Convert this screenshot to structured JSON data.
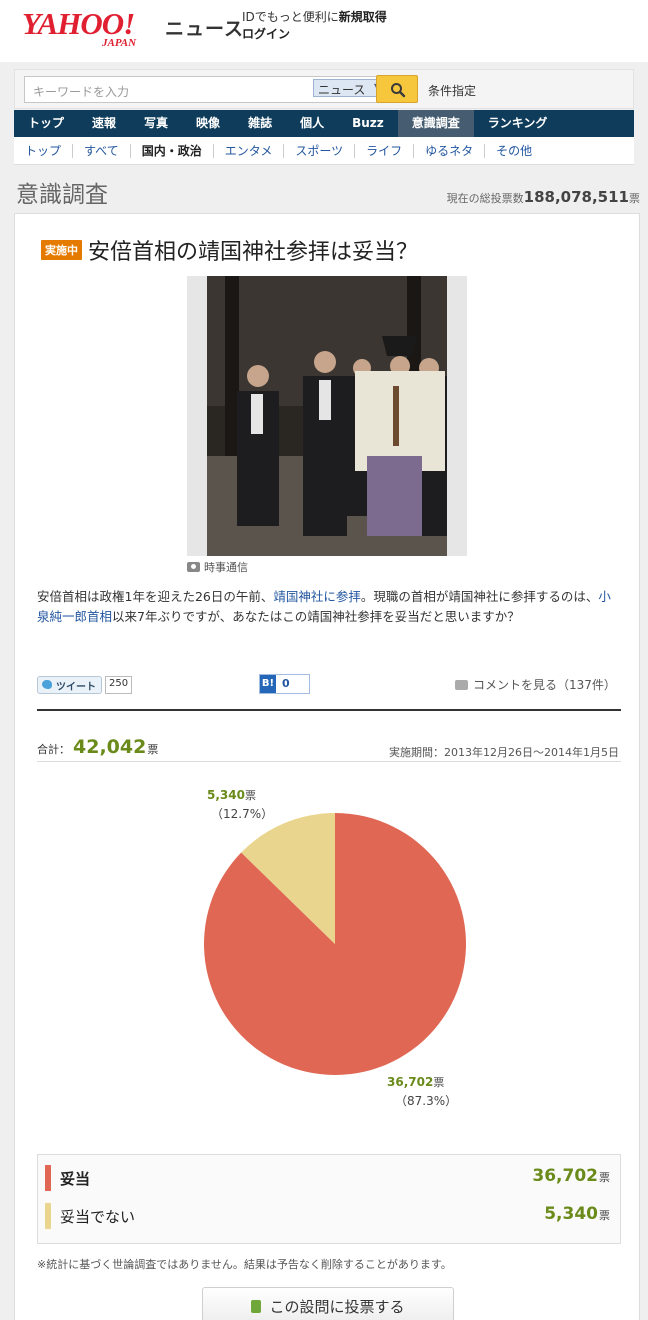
{
  "header": {
    "logo_main": "YAHOO!",
    "logo_sub": "JAPAN",
    "section": "ニュース",
    "id_text": "IDでもっと便利に",
    "register": "新規取得",
    "login": "ログイン"
  },
  "search": {
    "placeholder": "キーワードを入力",
    "scope": "ニュース",
    "advanced": "条件指定"
  },
  "main_nav": [
    "トップ",
    "速報",
    "写真",
    "映像",
    "雑誌",
    "個人",
    "Buzz",
    "意識調査",
    "ランキング"
  ],
  "main_nav_active": "意識調査",
  "sub_nav": [
    "トップ",
    "すべて",
    "国内・政治",
    "エンタメ",
    "スポーツ",
    "ライフ",
    "ゆるネタ",
    "その他"
  ],
  "sub_nav_current": "国内・政治",
  "page": {
    "title": "意識調査",
    "total_label": "現在の総投票数",
    "total_value": "188,078,511",
    "total_unit": "票"
  },
  "question": {
    "status": "実施中",
    "title": "安倍首相の靖国神社参拝は妥当？",
    "photo_credit": "時事通信",
    "desc_1": "安倍首相は政権1年を迎えた26日の午前、",
    "desc_link_1": "靖国神社に参拝",
    "desc_2": "。現職の首相が靖国神社に参拝するのは、",
    "desc_link_2": "小泉純一郎首相",
    "desc_3": "以来7年ぶりですが、あなたはこの靖国神社参拝を妥当だと思いますか？"
  },
  "social": {
    "tweet": "ツイート",
    "tweet_count": "250",
    "hatena_label": "B!",
    "hatena_count": "0",
    "comments": "コメントを見る（137件）"
  },
  "summary": {
    "total_label": "合計：",
    "total": "42,042",
    "unit": "票",
    "period": "実施期間：2013年12月26日～2014年1月5日"
  },
  "chart_data": {
    "type": "pie",
    "slices": [
      {
        "name": "妥当",
        "value": 36702,
        "percent": 87.3,
        "label": "36,702",
        "pct_label": "（87.3%）",
        "color": "#e06753"
      },
      {
        "name": "妥当でない",
        "value": 5340,
        "percent": 12.7,
        "label": "5,340",
        "pct_label": "（12.7%）",
        "color": "#e9d58e"
      }
    ],
    "unit": "票"
  },
  "results": [
    {
      "name": "妥当",
      "count": "36,702",
      "unit": "票",
      "color": "#e06753"
    },
    {
      "name": "妥当でない",
      "count": "5,340",
      "unit": "票",
      "color": "#e9d58e"
    }
  ],
  "note": "※統計に基づく世論調査ではありません。結果は予告なく削除することがあります。",
  "vote_button": "この設問に投票する"
}
